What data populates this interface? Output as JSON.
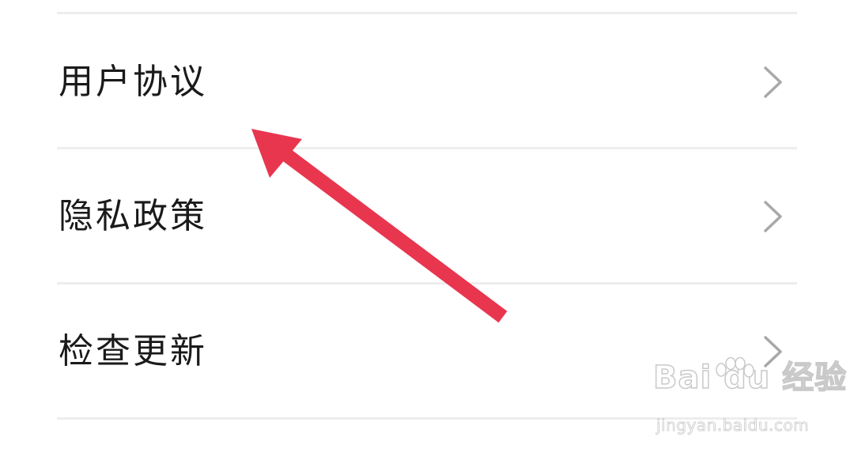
{
  "settings_list": {
    "items": [
      {
        "label": "用户协议",
        "icon": "chevron-right-icon"
      },
      {
        "label": "隐私政策",
        "icon": "chevron-right-icon"
      },
      {
        "label": "检查更新",
        "icon": "chevron-right-icon"
      }
    ]
  },
  "annotation": {
    "arrow_color": "#e8364f",
    "points_to": "用户协议"
  },
  "watermark": {
    "brand_text": "Bai  du 经验",
    "url": "jingyan.baidu.com"
  },
  "colors": {
    "background": "#ffffff",
    "divider": "#ededed",
    "text": "#1a1a1a",
    "chevron": "#a8a8a8"
  }
}
